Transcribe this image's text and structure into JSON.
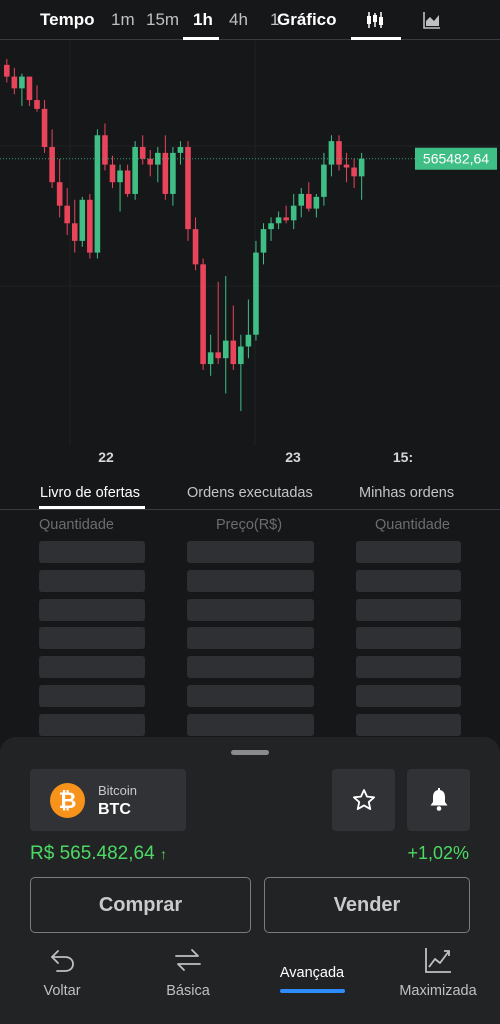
{
  "topbar": {
    "tempo_label": "Tempo",
    "intervals": [
      "1m",
      "15m",
      "1h",
      "4h",
      "1"
    ],
    "selected_interval": "1h",
    "grafico_label": "Gráfico"
  },
  "chart_data": {
    "type": "candlestick",
    "x_labels": [
      "22",
      "23",
      "15:"
    ],
    "current_price_label": "565482,64",
    "up_color": "#3fbf85",
    "down_color": "#e8455a",
    "candles": [
      {
        "o": 100,
        "h": 102,
        "l": 94,
        "c": 96
      },
      {
        "o": 96,
        "h": 99,
        "l": 90,
        "c": 92
      },
      {
        "o": 92,
        "h": 97,
        "l": 86,
        "c": 96
      },
      {
        "o": 96,
        "h": 96,
        "l": 86,
        "c": 88
      },
      {
        "o": 88,
        "h": 93,
        "l": 84,
        "c": 85
      },
      {
        "o": 85,
        "h": 88,
        "l": 70,
        "c": 72
      },
      {
        "o": 72,
        "h": 78,
        "l": 58,
        "c": 60
      },
      {
        "o": 60,
        "h": 68,
        "l": 48,
        "c": 52
      },
      {
        "o": 52,
        "h": 58,
        "l": 42,
        "c": 46
      },
      {
        "o": 46,
        "h": 54,
        "l": 36,
        "c": 40
      },
      {
        "o": 40,
        "h": 55,
        "l": 38,
        "c": 54
      },
      {
        "o": 54,
        "h": 56,
        "l": 34,
        "c": 36
      },
      {
        "o": 36,
        "h": 78,
        "l": 34,
        "c": 76
      },
      {
        "o": 76,
        "h": 80,
        "l": 64,
        "c": 66
      },
      {
        "o": 66,
        "h": 69,
        "l": 58,
        "c": 60
      },
      {
        "o": 60,
        "h": 66,
        "l": 50,
        "c": 64
      },
      {
        "o": 64,
        "h": 66,
        "l": 55,
        "c": 56
      },
      {
        "o": 56,
        "h": 74,
        "l": 54,
        "c": 72
      },
      {
        "o": 72,
        "h": 76,
        "l": 66,
        "c": 68
      },
      {
        "o": 68,
        "h": 71,
        "l": 62,
        "c": 66
      },
      {
        "o": 66,
        "h": 72,
        "l": 60,
        "c": 70
      },
      {
        "o": 70,
        "h": 76,
        "l": 54,
        "c": 56
      },
      {
        "o": 56,
        "h": 72,
        "l": 52,
        "c": 70
      },
      {
        "o": 70,
        "h": 74,
        "l": 66,
        "c": 72
      },
      {
        "o": 72,
        "h": 74,
        "l": 40,
        "c": 44
      },
      {
        "o": 44,
        "h": 48,
        "l": 30,
        "c": 32
      },
      {
        "o": 32,
        "h": 34,
        "l": -4,
        "c": -2
      },
      {
        "o": -2,
        "h": 8,
        "l": -6,
        "c": 2
      },
      {
        "o": 2,
        "h": 26,
        "l": -2,
        "c": 0
      },
      {
        "o": 0,
        "h": 28,
        "l": -12,
        "c": 6
      },
      {
        "o": 6,
        "h": 18,
        "l": -4,
        "c": -2
      },
      {
        "o": -2,
        "h": 8,
        "l": -18,
        "c": 4
      },
      {
        "o": 4,
        "h": 20,
        "l": 0,
        "c": 8
      },
      {
        "o": 8,
        "h": 40,
        "l": 6,
        "c": 36
      },
      {
        "o": 36,
        "h": 46,
        "l": 32,
        "c": 44
      },
      {
        "o": 44,
        "h": 48,
        "l": 40,
        "c": 46
      },
      {
        "o": 46,
        "h": 50,
        "l": 44,
        "c": 48
      },
      {
        "o": 48,
        "h": 52,
        "l": 46,
        "c": 47
      },
      {
        "o": 47,
        "h": 56,
        "l": 44,
        "c": 52
      },
      {
        "o": 52,
        "h": 58,
        "l": 48,
        "c": 56
      },
      {
        "o": 56,
        "h": 60,
        "l": 50,
        "c": 51
      },
      {
        "o": 51,
        "h": 56,
        "l": 48,
        "c": 55
      },
      {
        "o": 55,
        "h": 70,
        "l": 52,
        "c": 66
      },
      {
        "o": 66,
        "h": 76,
        "l": 62,
        "c": 74
      },
      {
        "o": 74,
        "h": 76,
        "l": 64,
        "c": 66
      },
      {
        "o": 66,
        "h": 70,
        "l": 60,
        "c": 65
      },
      {
        "o": 65,
        "h": 68,
        "l": 58,
        "c": 62
      },
      {
        "o": 62,
        "h": 70,
        "l": 54,
        "c": 68
      }
    ]
  },
  "orderbook": {
    "tabs": [
      "Livro de ofertas",
      "Ordens executadas",
      "Minhas ordens"
    ],
    "columns": [
      "Quantidade",
      "Preço(R$)",
      "Quantidade"
    ]
  },
  "sheet": {
    "asset_name": "Bitcoin",
    "asset_ticker": "BTC",
    "coin_symbol": "₿",
    "price": "R$ 565.482,64",
    "price_arrow": "↑",
    "change": "+1,02%",
    "buy_label": "Comprar",
    "sell_label": "Vender",
    "icons": {
      "favorite": "star-icon",
      "alert": "bell-icon"
    }
  },
  "nav": {
    "items": [
      {
        "label": "Voltar",
        "icon": "undo-arrow-icon"
      },
      {
        "label": "Básica",
        "icon": "swap-arrows-icon"
      },
      {
        "label": "Avançada",
        "icon": ""
      },
      {
        "label": "Maximizada",
        "icon": "trend-chart-icon"
      }
    ]
  }
}
